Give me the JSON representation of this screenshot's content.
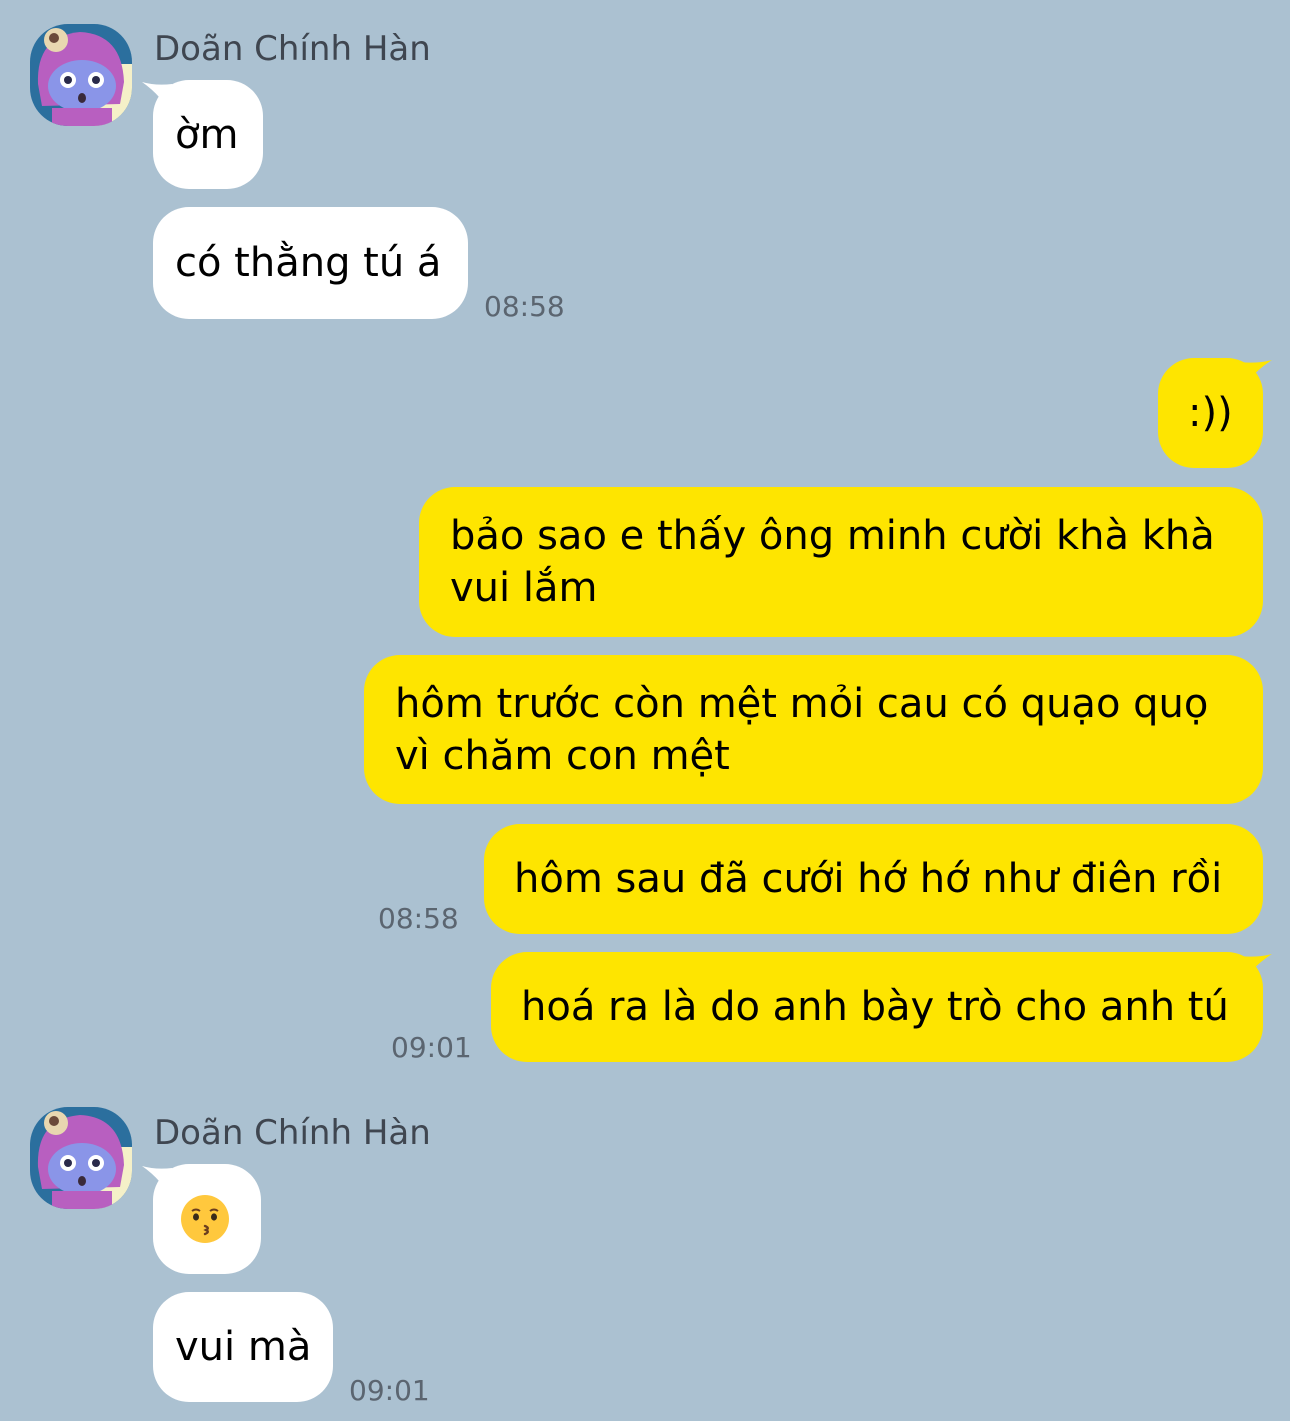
{
  "colors": {
    "background": "#abc1d1",
    "incoming_bubble": "#ffffff",
    "outgoing_bubble": "#fee500"
  },
  "groups": [
    {
      "sender": "Doãn Chính Hàn",
      "avatar_icon": "pink-hood-cartoon-avatar-icon",
      "messages": [
        {
          "text": "ờm"
        },
        {
          "text": "có thằng tú á"
        }
      ],
      "time": "08:58"
    },
    {
      "outgoing": true,
      "messages": [
        {
          "text": ":))"
        },
        {
          "text": "bảo sao e thấy ông minh cười khà khà vui lắm"
        },
        {
          "text": "hôm trước còn mệt mỏi cau có quạo quọ vì chăm con mệt"
        },
        {
          "text": "hôm sau đã cưới hớ hớ như điên rồi"
        },
        {
          "text": "hoá ra là do anh bày trò cho anh tú"
        }
      ],
      "times": [
        "08:58",
        "09:01"
      ]
    },
    {
      "sender": "Doãn Chính Hàn",
      "avatar_icon": "pink-hood-cartoon-avatar-icon",
      "messages": [
        {
          "emoji": "kissing-face-emoji"
        },
        {
          "text": "vui mà"
        }
      ],
      "time": "09:01"
    }
  ]
}
